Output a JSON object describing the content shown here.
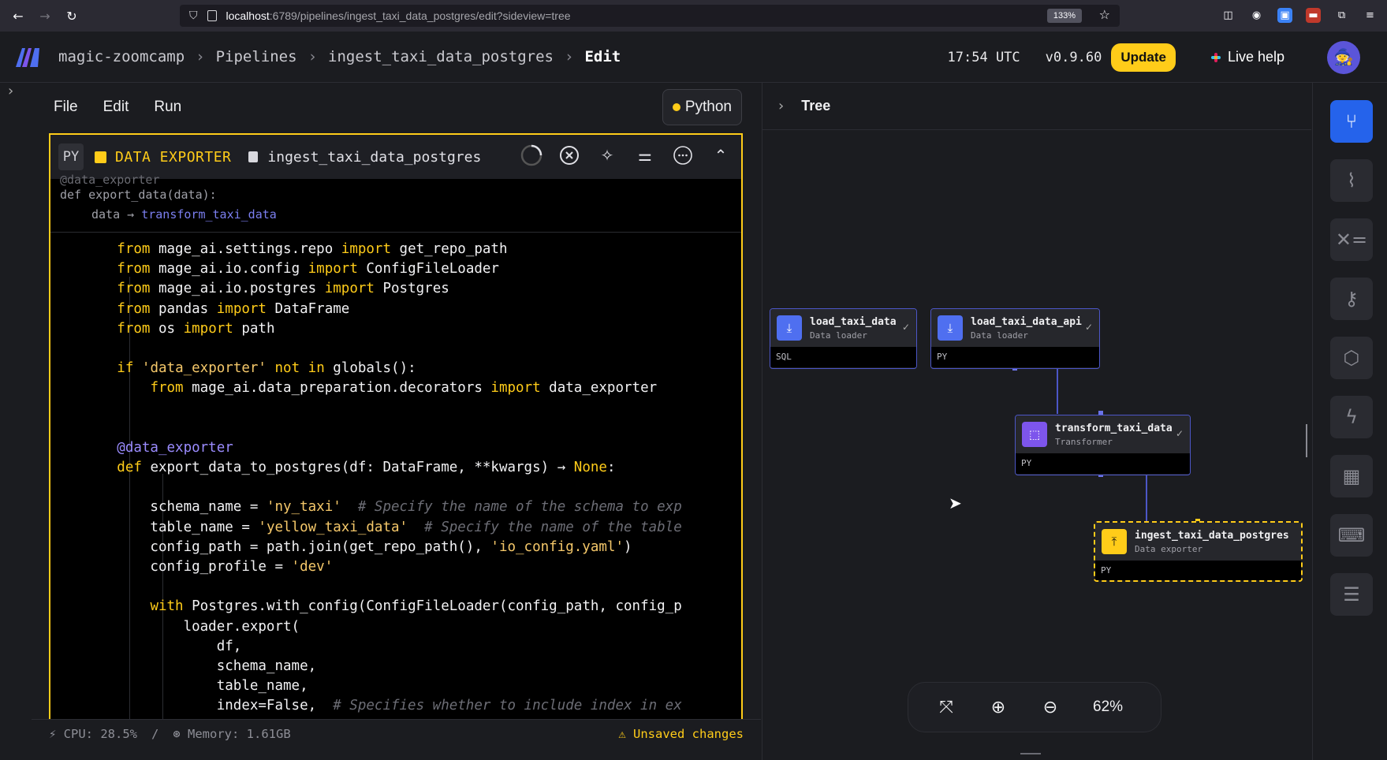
{
  "browser": {
    "url_host": "localhost",
    "url_rest": ":6789/pipelines/ingest_taxi_data_postgres/edit?sideview=tree",
    "zoom": "133%"
  },
  "header": {
    "project": "magic-zoomcamp",
    "crumb_pipelines": "Pipelines",
    "pipeline": "ingest_taxi_data_postgres",
    "current": "Edit",
    "time": "17:54 UTC",
    "version": "v0.9.60",
    "update_label": "Update",
    "live_help_label": "Live help"
  },
  "editor": {
    "menu": [
      "File",
      "Edit",
      "Run"
    ],
    "language_label": "Python",
    "block": {
      "lang_tag": "PY",
      "type_label": "DATA EXPORTER",
      "name": "ingest_taxi_data_postgres",
      "sig_line1": "@data_exporter",
      "sig_line2": "def export_data(data):",
      "sig_param": "data",
      "sig_link": "transform_taxi_data"
    },
    "code_lines": [
      "        from mage_ai.settings.repo import get_repo_path",
      "        from mage_ai.io.config import ConfigFileLoader",
      "        from mage_ai.io.postgres import Postgres",
      "        from pandas import DataFrame",
      "        from os import path",
      "",
      "        if 'data_exporter' not in globals():",
      "            from mage_ai.data_preparation.decorators import data_exporter",
      "",
      "",
      "        @data_exporter",
      "        def export_data_to_postgres(df: DataFrame, **kwargs) → None:",
      "",
      "            schema_name = 'ny_taxi'  # Specify the name of the schema to exp",
      "            table_name = 'yellow_taxi_data'  # Specify the name of the table",
      "            config_path = path.join(get_repo_path(), 'io_config.yaml')",
      "            config_profile = 'dev'",
      "",
      "            with Postgres.with_config(ConfigFileLoader(config_path, config_p",
      "                loader.export(",
      "                    df,",
      "                    schema_name,",
      "                    table_name,",
      "                    index=False,  # Specifies whether to include index in ex"
    ],
    "status": {
      "cpu": "CPU: 28.5%",
      "memory": "Memory: 1.61GB",
      "unsaved": "Unsaved changes"
    }
  },
  "tree": {
    "title": "Tree",
    "nodes": [
      {
        "name": "load_taxi_data",
        "type": "Data loader",
        "lang": "SQL",
        "color": "#4f6ff0"
      },
      {
        "name": "load_taxi_data_api",
        "type": "Data loader",
        "lang": "PY",
        "color": "#4f6ff0"
      },
      {
        "name": "transform_taxi_data",
        "type": "Transformer",
        "lang": "PY",
        "color": "#7d55ec"
      },
      {
        "name": "ingest_taxi_data_postgres",
        "type": "Data exporter",
        "lang": "PY",
        "color": "#ffcc19"
      }
    ],
    "zoom": "62%"
  },
  "rail": {
    "icons": [
      "tree-icon",
      "chart-icon",
      "variables-icon",
      "secrets-icon",
      "block-settings-icon",
      "triggers-icon",
      "table-icon",
      "terminal-icon",
      "settings-icon"
    ]
  },
  "colors": {
    "accent": "#ffcc19",
    "primary": "#2563eb",
    "node_border": "#4c56c7"
  }
}
